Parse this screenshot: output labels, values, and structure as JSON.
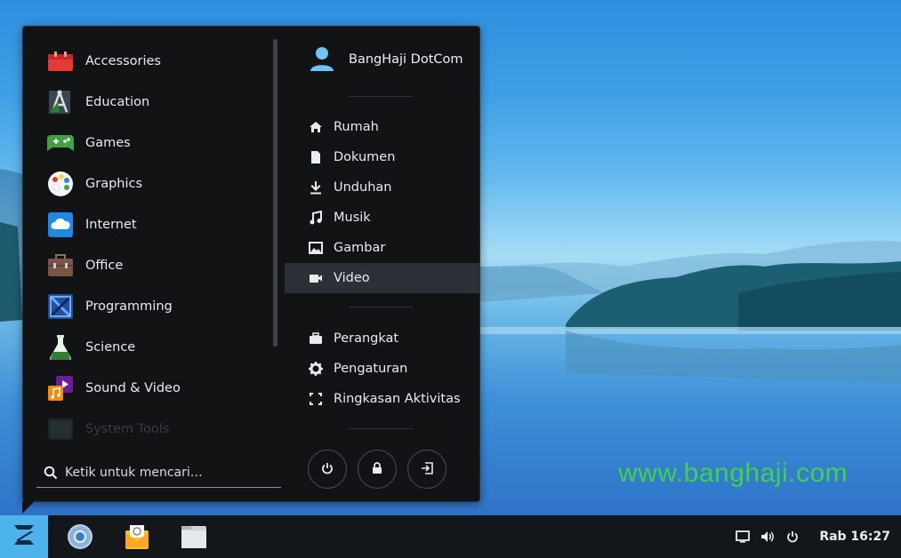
{
  "menu": {
    "categories": [
      {
        "label": "Accessories",
        "icon": "accessories-icon"
      },
      {
        "label": "Education",
        "icon": "education-icon"
      },
      {
        "label": "Games",
        "icon": "games-icon"
      },
      {
        "label": "Graphics",
        "icon": "graphics-icon"
      },
      {
        "label": "Internet",
        "icon": "internet-icon"
      },
      {
        "label": "Office",
        "icon": "office-icon"
      },
      {
        "label": "Programming",
        "icon": "programming-icon"
      },
      {
        "label": "Science",
        "icon": "science-icon"
      },
      {
        "label": "Sound & Video",
        "icon": "sound-video-icon"
      },
      {
        "label": "System Tools",
        "icon": "system-tools-icon"
      }
    ],
    "search": {
      "placeholder": "Ketik untuk mencari…"
    },
    "user": {
      "name": "BangHaji DotCom"
    },
    "places": [
      {
        "label": "Rumah",
        "icon": "home-icon"
      },
      {
        "label": "Dokumen",
        "icon": "document-icon"
      },
      {
        "label": "Unduhan",
        "icon": "download-icon"
      },
      {
        "label": "Musik",
        "icon": "music-icon"
      },
      {
        "label": "Gambar",
        "icon": "image-icon"
      },
      {
        "label": "Video",
        "icon": "video-icon",
        "active": true
      }
    ],
    "system": [
      {
        "label": "Perangkat",
        "icon": "briefcase-icon"
      },
      {
        "label": "Pengaturan",
        "icon": "gear-icon"
      },
      {
        "label": "Ringkasan Aktivitas",
        "icon": "activities-icon"
      }
    ],
    "power_buttons": [
      "power-icon",
      "lock-icon",
      "logout-icon"
    ]
  },
  "watermark": "www.banghaji.com",
  "taskbar": {
    "apps": [
      "chromium-icon",
      "mail-icon",
      "files-icon"
    ],
    "clock": "Rab 16:27"
  },
  "colors": {
    "accent": "#4cb4ea",
    "menu_bg": "#111315",
    "active_row": "#2b3136"
  }
}
